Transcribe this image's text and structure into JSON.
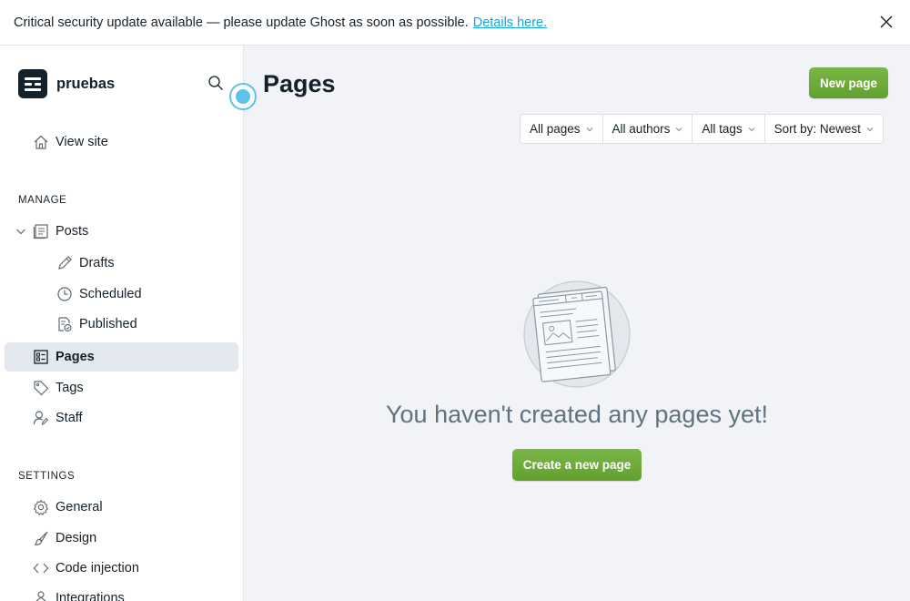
{
  "banner": {
    "message": "Critical security update available — please update Ghost as soon as possible.",
    "link": "Details here."
  },
  "sidebar": {
    "site_name": "pruebas",
    "view_site": "View site",
    "manage_title": "MANAGE",
    "posts": "Posts",
    "drafts": "Drafts",
    "scheduled": "Scheduled",
    "published": "Published",
    "pages": "Pages",
    "tags": "Tags",
    "staff": "Staff",
    "settings_title": "SETTINGS",
    "general": "General",
    "design": "Design",
    "code_injection": "Code injection",
    "integrations": "Integrations"
  },
  "main": {
    "title": "Pages",
    "new_page_button": "New page",
    "filters": {
      "pages": "All pages",
      "authors": "All authors",
      "tags": "All tags",
      "sort": "Sort by: Newest"
    },
    "empty_message": "You haven't created any pages yet!",
    "create_button": "Create a new page"
  },
  "colors": {
    "accent": "#6aa838",
    "link": "#14a4e0",
    "text": "#15212a",
    "muted": "#5f7380",
    "active_bg": "#e3e9ef"
  },
  "icons": [
    "close-icon",
    "search-icon",
    "home-icon",
    "posts-icon",
    "chevron-down-icon",
    "pencil-icon",
    "clock-icon",
    "published-icon",
    "pages-icon",
    "tag-icon",
    "staff-icon",
    "gear-icon",
    "brush-icon",
    "code-icon",
    "integrations-icon"
  ]
}
